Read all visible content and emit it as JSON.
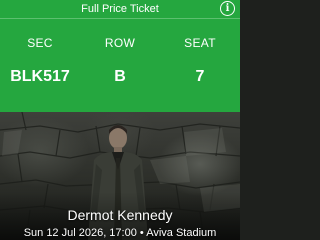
{
  "header": {
    "ticket_type": "Full Price Ticket",
    "info_icon": "info-icon"
  },
  "seat_info": {
    "section": {
      "label": "SEC",
      "value": "BLK517"
    },
    "row": {
      "label": "ROW",
      "value": "B"
    },
    "seat": {
      "label": "SEAT",
      "value": "7"
    }
  },
  "event": {
    "artist": "Dermot Kennedy",
    "details": "Sun 12 Jul 2026, 17:00 • Aviva Stadium"
  },
  "colors": {
    "header_background": "#25a73f",
    "text": "#ffffff"
  }
}
